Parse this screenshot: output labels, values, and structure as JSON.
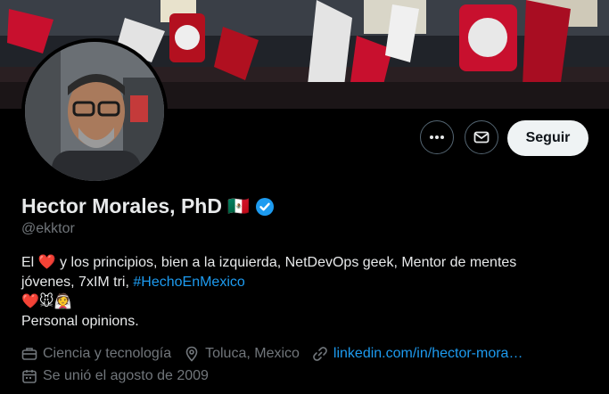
{
  "profile": {
    "name": "Hector Morales, PhD",
    "flag": "🇲🇽",
    "handle": "@ekktor",
    "bio_line1_start": "El ",
    "bio_line1_heart": "❤️",
    "bio_line1_rest": " y los principios, bien a la izquierda, NetDevOps geek, Mentor de mentes",
    "bio_line2": "jóvenes, 7xIM tri, ",
    "bio_hashtag": "#HechoEnMexico",
    "bio_emojis": "❤️🐭👰",
    "bio_line4": "Personal opinions.",
    "category": "Ciencia y tecnología",
    "location": "Toluca, Mexico",
    "website": "linkedin.com/in/hector-mora…",
    "joined": "Se unió el agosto de 2009"
  },
  "actions": {
    "more_icon": "more-dots-icon",
    "message_icon": "envelope-icon",
    "follow_label": "Seguir"
  },
  "colors": {
    "link": "#1d9bf0",
    "muted": "#71767b",
    "verified": "#1d9bf0",
    "follow_bg": "#eff3f4"
  }
}
